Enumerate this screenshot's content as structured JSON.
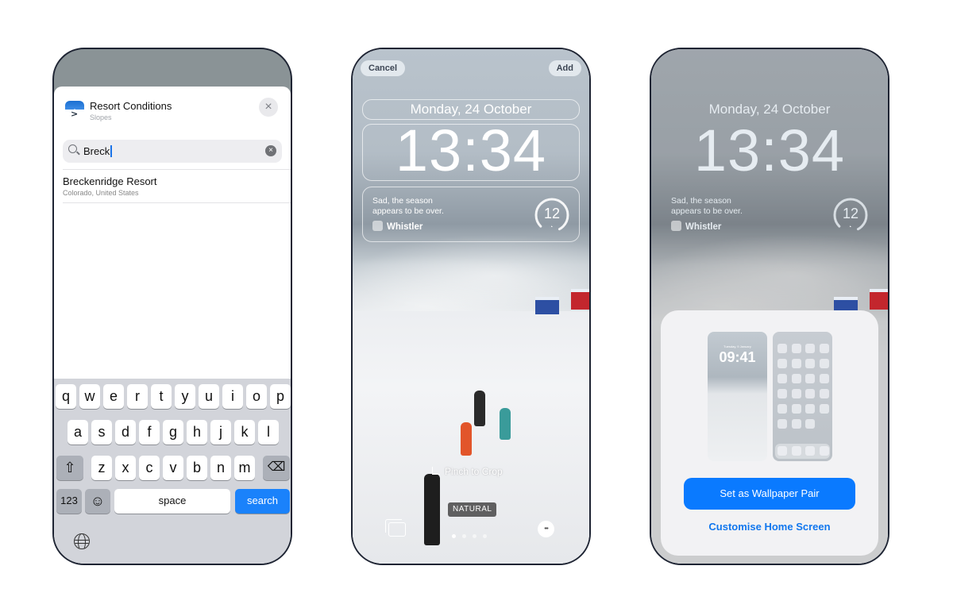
{
  "phone1": {
    "app": {
      "title": "Resort Conditions",
      "subtitle": "Slopes",
      "icon": "slopes-app-icon"
    },
    "close_icon": "×",
    "search": {
      "value": "Breck",
      "clear_icon": "×"
    },
    "results": [
      {
        "title": "Breckenridge Resort",
        "subtitle": "Colorado, United States"
      }
    ],
    "keyboard": {
      "row1": [
        "q",
        "w",
        "e",
        "r",
        "t",
        "y",
        "u",
        "i",
        "o",
        "p"
      ],
      "row2": [
        "a",
        "s",
        "d",
        "f",
        "g",
        "h",
        "j",
        "k",
        "l"
      ],
      "row3": [
        "z",
        "x",
        "c",
        "v",
        "b",
        "n",
        "m"
      ],
      "shift_icon": "⇧",
      "delete_icon": "⌫",
      "numbers_label": "123",
      "emoji_icon": "☺",
      "space_label": "space",
      "search_label": "search"
    }
  },
  "phone2": {
    "cancel_label": "Cancel",
    "add_label": "Add",
    "date": "Monday, 24 October",
    "time": "13:34",
    "widget": {
      "text": "Sad, the season appears to be over.",
      "location": "Whistler",
      "gauge_value": "12"
    },
    "crop_hint": "Pinch to Crop",
    "filter_badge": "NATURAL",
    "page_dots": 4,
    "active_dot": 0,
    "more_icon": "•••"
  },
  "phone3": {
    "date": "Monday, 24 October",
    "time": "13:34",
    "widget": {
      "text": "Sad, the season appears to be over.",
      "location": "Whistler",
      "gauge_value": "12"
    },
    "preview": {
      "date": "Tuesday, 9 January",
      "time": "09:41"
    },
    "primary_button": "Set as Wallpaper Pair",
    "secondary_link": "Customise Home Screen"
  },
  "colors": {
    "accent": "#0a7aff",
    "frame": "#1e2433",
    "keyboard_bg": "#d2d4da"
  }
}
